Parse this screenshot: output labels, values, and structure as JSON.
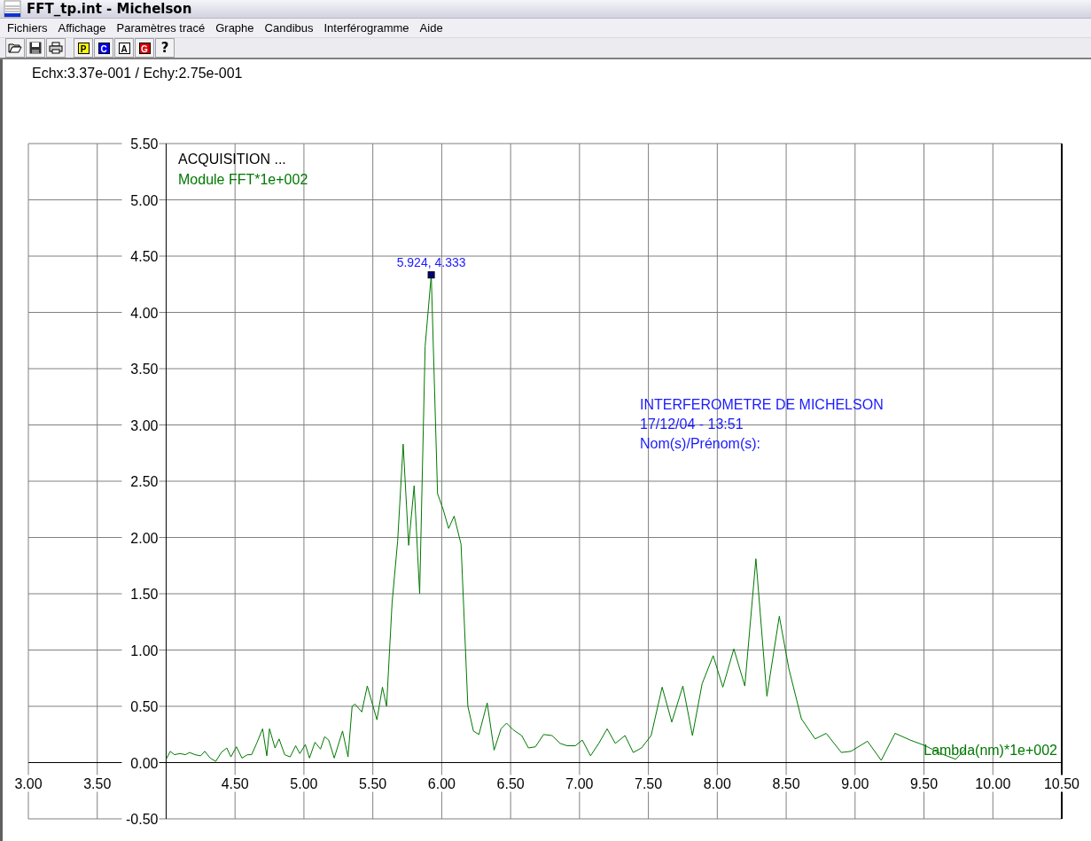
{
  "window": {
    "title": "FFT_tp.int - Michelson"
  },
  "menu": [
    {
      "label": "Fichiers"
    },
    {
      "label": "Affichage"
    },
    {
      "label": "Paramètres tracé"
    },
    {
      "label": "Graphe"
    },
    {
      "label": "Candibus"
    },
    {
      "label": "Interférogramme"
    },
    {
      "label": "Aide"
    }
  ],
  "toolbar": {
    "letter_buttons": [
      {
        "label": "P",
        "color": "#ffff00"
      },
      {
        "label": "C",
        "color": "#0000ff"
      },
      {
        "label": "A",
        "color": "#ffffff"
      },
      {
        "label": "G",
        "color": "#e00000"
      }
    ],
    "help_button": "?"
  },
  "scale_label": "Echx:3.37e-001 / Echy:2.75e-001",
  "chart": {
    "chart_data": {
      "type": "line",
      "xlabel": "Lambda(nm)*1e+002",
      "xlim": [
        3,
        10.5
      ],
      "ylim": [
        -0.5,
        5.5
      ],
      "xticks": [
        {
          "value": 3,
          "label": "3.00"
        },
        {
          "value": 3.5,
          "label": "3.50"
        },
        {
          "value": 4.5,
          "label": "4.50"
        },
        {
          "value": 5,
          "label": "5.00"
        },
        {
          "value": 5.5,
          "label": "5.50"
        },
        {
          "value": 6,
          "label": "6.00"
        },
        {
          "value": 6.5,
          "label": "6.50"
        },
        {
          "value": 7,
          "label": "7.00"
        },
        {
          "value": 7.5,
          "label": "7.50"
        },
        {
          "value": 8,
          "label": "8.00"
        },
        {
          "value": 8.5,
          "label": "8.50"
        },
        {
          "value": 9,
          "label": "9.00"
        },
        {
          "value": 9.5,
          "label": "9.50"
        },
        {
          "value": 10,
          "label": "10.00"
        },
        {
          "value": 10.5,
          "label": "10.50"
        }
      ],
      "yticks": [
        {
          "value": -0.5,
          "label": "-0.50"
        },
        {
          "value": 0,
          "label": "0.00"
        },
        {
          "value": 0.5,
          "label": "0.50"
        },
        {
          "value": 1,
          "label": "1.00"
        },
        {
          "value": 1.5,
          "label": "1.50"
        },
        {
          "value": 2,
          "label": "2.00"
        },
        {
          "value": 2.5,
          "label": "2.50"
        },
        {
          "value": 3,
          "label": "3.00"
        },
        {
          "value": 3.5,
          "label": "3.50"
        },
        {
          "value": 4,
          "label": "4.00"
        },
        {
          "value": 4.5,
          "label": "4.50"
        },
        {
          "value": 5,
          "label": "5.00"
        },
        {
          "value": 5.5,
          "label": "5.50"
        }
      ],
      "x": [
        4.0,
        4.03,
        4.06,
        4.1,
        4.14,
        4.17,
        4.21,
        4.25,
        4.28,
        4.32,
        4.36,
        4.4,
        4.44,
        4.47,
        4.51,
        4.55,
        4.59,
        4.62,
        4.66,
        4.7,
        4.73,
        4.75,
        4.79,
        4.82,
        4.86,
        4.9,
        4.94,
        4.97,
        5.01,
        5.04,
        5.08,
        5.12,
        5.15,
        5.18,
        5.22,
        5.28,
        5.32,
        5.35,
        5.37,
        5.42,
        5.46,
        5.53,
        5.57,
        5.6,
        5.64,
        5.68,
        5.72,
        5.76,
        5.8,
        5.84,
        5.88,
        5.924,
        5.97,
        6.01,
        6.05,
        6.09,
        6.14,
        6.19,
        6.23,
        6.27,
        6.33,
        6.38,
        6.43,
        6.47,
        6.52,
        6.58,
        6.63,
        6.68,
        6.74,
        6.8,
        6.86,
        6.91,
        6.97,
        7.02,
        7.08,
        7.14,
        7.2,
        7.26,
        7.33,
        7.39,
        7.45,
        7.52,
        7.6,
        7.67,
        7.75,
        7.82,
        7.89,
        7.97,
        8.04,
        8.12,
        8.2,
        8.28,
        8.36,
        8.45,
        8.52,
        8.61,
        8.71,
        8.79,
        8.9,
        8.97,
        9.09,
        9.19,
        9.29,
        9.4,
        9.51,
        9.62,
        9.73,
        9.8
      ],
      "series": [
        {
          "name": "Module FFT*1e+002",
          "color": "#007800",
          "values": [
            0.03,
            0.1,
            0.07,
            0.08,
            0.07,
            0.09,
            0.07,
            0.06,
            0.1,
            0.04,
            0.01,
            0.09,
            0.13,
            0.05,
            0.14,
            0.04,
            0.07,
            0.07,
            0.18,
            0.3,
            0.06,
            0.3,
            0.13,
            0.21,
            0.07,
            0.05,
            0.15,
            0.08,
            0.16,
            0.04,
            0.18,
            0.12,
            0.23,
            0.2,
            0.04,
            0.28,
            0.05,
            0.5,
            0.52,
            0.45,
            0.68,
            0.38,
            0.67,
            0.5,
            1.42,
            1.97,
            2.83,
            1.93,
            2.46,
            1.5,
            3.7,
            4.333,
            2.39,
            2.25,
            2.08,
            2.19,
            1.94,
            0.5,
            0.28,
            0.25,
            0.53,
            0.11,
            0.3,
            0.35,
            0.29,
            0.24,
            0.13,
            0.14,
            0.25,
            0.24,
            0.17,
            0.15,
            0.15,
            0.2,
            0.06,
            0.17,
            0.3,
            0.17,
            0.24,
            0.09,
            0.13,
            0.24,
            0.67,
            0.36,
            0.68,
            0.24,
            0.7,
            0.95,
            0.67,
            1.01,
            0.68,
            1.81,
            0.59,
            1.3,
            0.83,
            0.39,
            0.21,
            0.26,
            0.09,
            0.1,
            0.19,
            0.02,
            0.26,
            0.2,
            0.15,
            0.08,
            0.03,
            0.12
          ]
        }
      ],
      "grid": true,
      "annotations": [
        {
          "x": 5.924,
          "y": 4.333,
          "text": "5.924, 4.333"
        }
      ]
    },
    "status_text": "ACQUISITION ...",
    "note_lines": [
      "INTERFEROMETRE DE MICHELSON",
      "17/12/04 - 13:51",
      "Nom(s)/Prénom(s):"
    ]
  }
}
